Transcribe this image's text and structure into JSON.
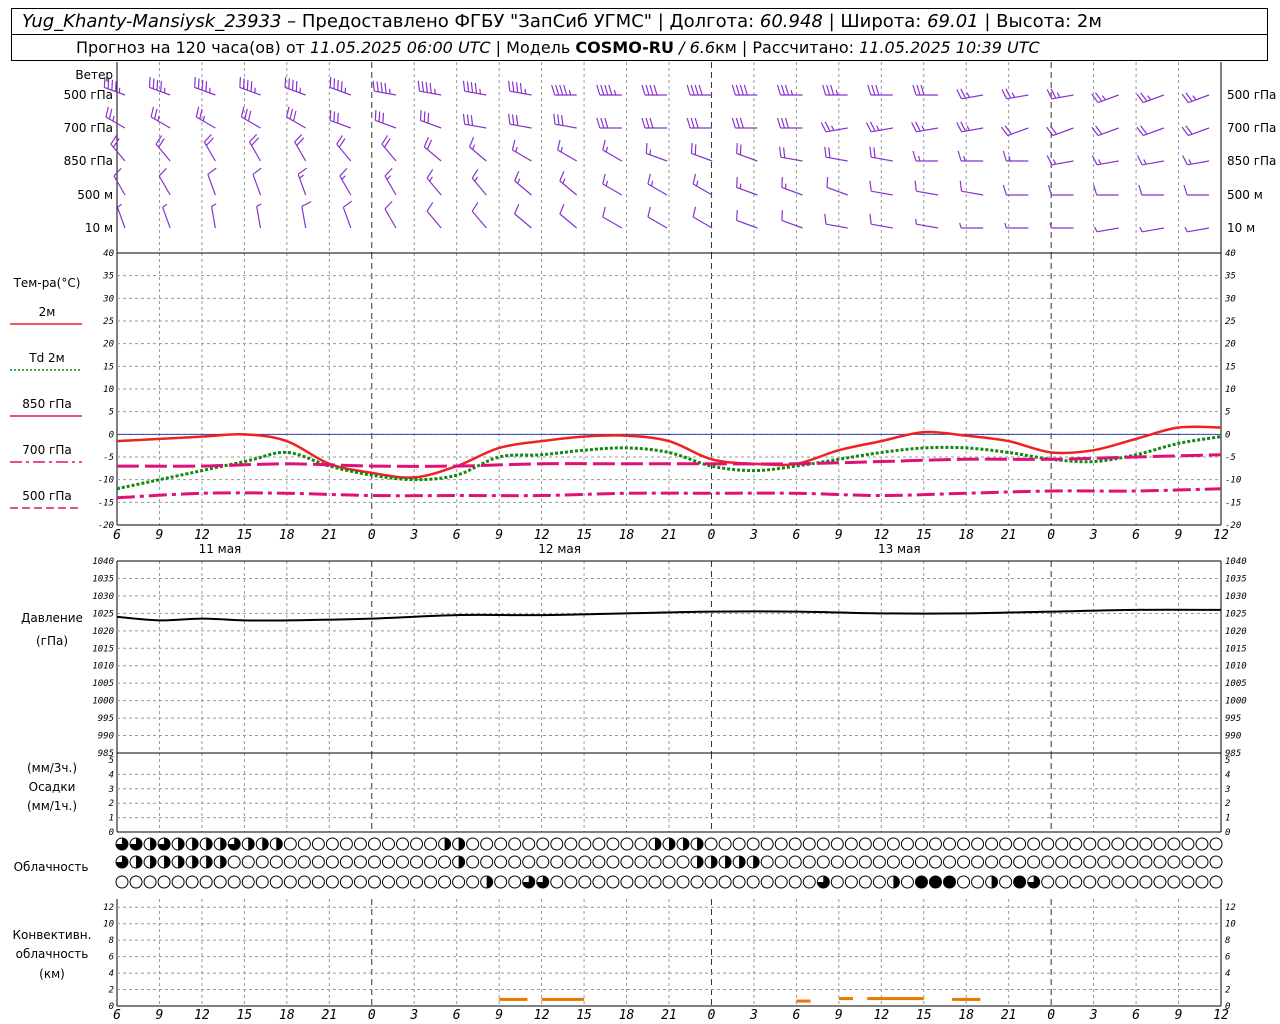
{
  "header": {
    "station": "Yug_Khanty-Mansiysk_23933",
    "provider": " – Предоставлено ФГБУ \"ЗапСиб УГМС\" | Долгота: ",
    "longitude": "60.948",
    "sep_lat": " | Широта: ",
    "latitude": "69.01",
    "sep_alt": " | Высота: 2м",
    "forecast_prefix": "Прогноз на 120 часа(ов) от ",
    "forecast_start": "11.05.2025 06:00 UTC",
    "model_prefix": "  | Модель ",
    "model": "COSMO-RU",
    "model_res": " / 6.6",
    "model_unit": "км | Рассчитано: ",
    "computed": "11.05.2025 10:39 UTC"
  },
  "labels": {
    "wind": "Ветер",
    "wind_levels": [
      "500 гПа",
      "700 гПа",
      "850 гПа",
      "500 м",
      "10  м"
    ],
    "temp": "Тем-ра(°C)",
    "legend": [
      {
        "text": "2м",
        "color": "#ee2222",
        "style": "solid"
      },
      {
        "text": "Td  2м",
        "color": "#118811",
        "style": "dot"
      },
      {
        "text": "850 гПа",
        "color": "#dd1177",
        "style": "solid"
      },
      {
        "text": "700 гПа",
        "color": "#dd1177",
        "style": "dashdot"
      },
      {
        "text": "500 гПа",
        "color": "#dd1177",
        "style": "dash"
      }
    ],
    "pressure": [
      "Давление",
      "(гПа)"
    ],
    "precip": [
      "(мм/3ч.)",
      "Осадки",
      "(мм/1ч.)"
    ],
    "clouds": "Облачность",
    "convective": [
      "Конвективн.",
      "облачность",
      "(км)"
    ]
  },
  "time_axis": {
    "ticks": [
      "6",
      "9",
      "12",
      "15",
      "18",
      "21",
      "0",
      "3",
      "6",
      "9",
      "12",
      "15",
      "18",
      "21",
      "0",
      "3",
      "6",
      "9",
      "12",
      "15",
      "18",
      "21",
      "0",
      "3",
      "6",
      "9",
      "12"
    ],
    "dates": [
      {
        "index": 2,
        "text": "11 мая"
      },
      {
        "index": 10,
        "text": "12 мая"
      },
      {
        "index": 18,
        "text": "13 мая"
      }
    ]
  },
  "chart_data": [
    {
      "type": "line",
      "title": "Тем-ра(°C)",
      "x_unit": "hours since 11.05.2025 06:00 UTC",
      "ylim": [
        -20,
        40
      ],
      "y_ticks": [
        -20,
        -15,
        -10,
        -5,
        0,
        5,
        10,
        15,
        20,
        25,
        30,
        35,
        40
      ],
      "series": [
        {
          "name": "2м",
          "color": "#ee2222",
          "x": [
            0,
            6,
            9,
            12,
            15,
            18,
            21,
            24,
            27,
            30,
            33,
            36,
            39,
            42,
            45,
            48,
            51,
            54,
            57,
            60,
            63,
            66,
            69,
            72,
            75,
            78
          ],
          "y": [
            -1.5,
            -0.5,
            0,
            -1.5,
            -6.5,
            -8.5,
            -9.5,
            -7,
            -3,
            -1.5,
            -0.5,
            -0.3,
            -1.5,
            -5.5,
            -6.5,
            -6.5,
            -3.5,
            -1.5,
            0.5,
            -0.3,
            -1.5,
            -4,
            -3.5,
            -1,
            1.5,
            1.5
          ]
        },
        {
          "name": "Td  2м",
          "color": "#118811",
          "x": [
            0,
            3,
            9,
            12,
            15,
            18,
            21,
            24,
            27,
            30,
            33,
            36,
            39,
            42,
            45,
            48,
            51,
            54,
            57,
            60,
            63,
            66,
            69,
            72,
            75,
            78
          ],
          "y": [
            -12,
            -10,
            -6,
            -4,
            -7,
            -9,
            -10,
            -9,
            -5,
            -4.5,
            -3.5,
            -3,
            -4,
            -7,
            -8,
            -7,
            -5.5,
            -4,
            -3,
            -3,
            -4,
            -5.5,
            -6,
            -4.5,
            -2,
            -0.5
          ]
        },
        {
          "name": "850 гПа",
          "color": "#dd1177",
          "x": [
            0,
            6,
            12,
            18,
            24,
            30,
            36,
            42,
            48,
            54,
            60,
            66,
            72,
            78
          ],
          "y": [
            -7,
            -7,
            -6.5,
            -7,
            -7,
            -6.5,
            -6.5,
            -6.5,
            -6.5,
            -6,
            -5.5,
            -5.5,
            -5,
            -4.5
          ]
        },
        {
          "name": "500 гПа",
          "color": "#dd1177",
          "x": [
            0,
            6,
            12,
            18,
            24,
            30,
            36,
            42,
            48,
            54,
            60,
            66,
            72,
            78
          ],
          "y": [
            -14,
            -13,
            -13,
            -13.5,
            -13.5,
            -13.5,
            -13,
            -13,
            -13,
            -13.5,
            -13,
            -12.5,
            -12.5,
            -12
          ]
        }
      ]
    },
    {
      "type": "line",
      "title": "Давление",
      "ylabel": "(гПа)",
      "ylim": [
        985,
        1040
      ],
      "y_ticks": [
        985,
        990,
        995,
        1000,
        1005,
        1010,
        1015,
        1020,
        1025,
        1030,
        1035,
        1040
      ],
      "series": [
        {
          "name": "Давление",
          "color": "#000000",
          "x": [
            0,
            3,
            6,
            9,
            12,
            18,
            24,
            30,
            36,
            42,
            48,
            54,
            60,
            66,
            72,
            78
          ],
          "y": [
            1024,
            1023,
            1023.5,
            1023,
            1023,
            1023.5,
            1024.5,
            1024.5,
            1025,
            1025.5,
            1025.5,
            1025,
            1025,
            1025.5,
            1026,
            1026
          ]
        }
      ]
    },
    {
      "type": "bar",
      "title": "Осадки",
      "ylim": [
        0,
        5
      ],
      "y_ticks": [
        0,
        1,
        2,
        3,
        4,
        5
      ],
      "values": []
    },
    {
      "type": "bar",
      "title": "Конвективн. облачность (км)",
      "ylim": [
        0,
        13
      ],
      "y_ticks": [
        0,
        2,
        4,
        6,
        8,
        10,
        12
      ],
      "color": "#ee7700",
      "bars": [
        {
          "x0": 27,
          "x1": 29,
          "value": 0.8
        },
        {
          "x0": 30,
          "x1": 33,
          "value": 0.8
        },
        {
          "x0": 48,
          "x1": 49,
          "value": 0.6
        },
        {
          "x0": 51,
          "x1": 52,
          "value": 0.9
        },
        {
          "x0": 53,
          "x1": 57,
          "value": 0.9
        },
        {
          "x0": 59,
          "x1": 61,
          "value": 0.8
        }
      ]
    }
  ],
  "clouds": {
    "note": "cloud cover fraction per row (0..1), 79 columns each",
    "rows": [
      [
        0.75,
        0.75,
        0.5,
        0.75,
        0.5,
        0.5,
        0.5,
        0.5,
        0.75,
        0.5,
        0.5,
        0.5,
        0,
        0,
        0,
        0,
        0,
        0,
        0,
        0,
        0,
        0,
        0,
        0.5,
        0.5,
        0,
        0,
        0,
        0,
        0,
        0,
        0,
        0,
        0,
        0,
        0,
        0,
        0,
        0.5,
        0.5,
        0.5,
        0.5,
        0,
        0,
        0,
        0,
        0,
        0,
        0,
        0,
        0,
        0,
        0,
        0,
        0,
        0,
        0,
        0,
        0,
        0,
        0,
        0,
        0,
        0,
        0,
        0,
        0,
        0,
        0,
        0,
        0,
        0,
        0,
        0,
        0,
        0,
        0,
        0,
        0
      ],
      [
        0.75,
        0.5,
        0.5,
        0.5,
        0.5,
        0.5,
        0.5,
        0.5,
        0,
        0,
        0,
        0,
        0,
        0,
        0,
        0,
        0,
        0,
        0,
        0,
        0,
        0,
        0,
        0,
        0.5,
        0,
        0,
        0,
        0,
        0,
        0,
        0,
        0,
        0,
        0,
        0,
        0,
        0,
        0,
        0,
        0,
        0.5,
        0.5,
        0.5,
        0.5,
        0.5,
        0,
        0,
        0,
        0,
        0,
        0,
        0,
        0,
        0,
        0,
        0,
        0,
        0,
        0,
        0,
        0,
        0,
        0,
        0,
        0,
        0,
        0,
        0,
        0,
        0,
        0,
        0,
        0,
        0,
        0,
        0,
        0,
        0
      ],
      [
        0,
        0,
        0,
        0,
        0,
        0,
        0,
        0,
        0,
        0,
        0,
        0,
        0,
        0,
        0,
        0,
        0,
        0,
        0,
        0,
        0,
        0,
        0,
        0,
        0,
        0,
        0.5,
        0,
        0,
        0.75,
        0.75,
        0,
        0,
        0,
        0,
        0,
        0,
        0,
        0,
        0,
        0,
        0,
        0,
        0,
        0,
        0,
        0,
        0,
        0,
        0,
        0.75,
        0,
        0,
        0,
        0,
        0.5,
        0,
        1,
        1,
        1,
        0,
        0,
        0.5,
        0,
        1,
        0.75,
        0,
        0,
        0,
        0,
        0,
        0,
        0,
        0,
        0,
        0,
        0,
        0,
        0
      ]
    ]
  },
  "wind": {
    "note": "barb rows from top: 500 гПа, 700 гПа, 850 гПа, 500 м, 10 м; dir = degrees wind comes from, spd = knots",
    "rows": [
      {
        "dir": [
          290,
          290,
          290,
          290,
          290,
          290,
          280,
          280,
          280,
          280,
          270,
          270,
          270,
          270,
          270,
          270,
          270,
          270,
          270,
          260,
          260,
          260,
          250,
          250,
          250
        ],
        "spd": [
          45,
          45,
          45,
          45,
          45,
          45,
          45,
          45,
          45,
          45,
          45,
          45,
          40,
          40,
          40,
          35,
          35,
          30,
          30,
          25,
          25,
          25,
          25,
          25,
          25
        ]
      },
      {
        "dir": [
          300,
          300,
          300,
          300,
          300,
          290,
          290,
          290,
          280,
          280,
          280,
          270,
          270,
          270,
          270,
          270,
          260,
          260,
          260,
          260,
          250,
          250,
          250,
          250,
          250
        ],
        "spd": [
          25,
          25,
          25,
          30,
          30,
          30,
          30,
          30,
          30,
          30,
          30,
          30,
          30,
          30,
          30,
          30,
          25,
          25,
          25,
          25,
          20,
          20,
          20,
          20,
          20
        ]
      },
      {
        "dir": [
          320,
          320,
          330,
          330,
          330,
          320,
          320,
          310,
          310,
          300,
          300,
          300,
          290,
          290,
          290,
          280,
          280,
          280,
          270,
          270,
          270,
          260,
          260,
          260,
          260
        ],
        "spd": [
          20,
          20,
          20,
          20,
          20,
          20,
          20,
          20,
          15,
          15,
          15,
          15,
          15,
          20,
          20,
          20,
          20,
          20,
          15,
          15,
          15,
          15,
          15,
          15,
          15
        ]
      },
      {
        "dir": [
          330,
          330,
          340,
          340,
          340,
          330,
          330,
          320,
          320,
          310,
          310,
          300,
          300,
          300,
          290,
          290,
          290,
          280,
          280,
          280,
          270,
          270,
          270,
          270,
          270
        ],
        "spd": [
          10,
          10,
          10,
          10,
          15,
          15,
          15,
          15,
          15,
          15,
          15,
          15,
          15,
          15,
          15,
          15,
          10,
          10,
          10,
          10,
          10,
          10,
          10,
          10,
          10
        ]
      },
      {
        "dir": [
          340,
          340,
          350,
          350,
          350,
          340,
          330,
          320,
          320,
          310,
          310,
          300,
          300,
          300,
          290,
          290,
          280,
          280,
          280,
          270,
          270,
          270,
          260,
          260,
          260
        ],
        "spd": [
          5,
          5,
          5,
          5,
          10,
          10,
          10,
          10,
          10,
          10,
          10,
          10,
          10,
          10,
          10,
          10,
          10,
          10,
          5,
          5,
          5,
          5,
          5,
          5,
          5
        ]
      }
    ]
  },
  "colors": {
    "wind": "#8833cc",
    "grid": "#999999",
    "zero_line": "#3344aa",
    "cloud_fill": "#000000",
    "convective": "#ee7700"
  }
}
